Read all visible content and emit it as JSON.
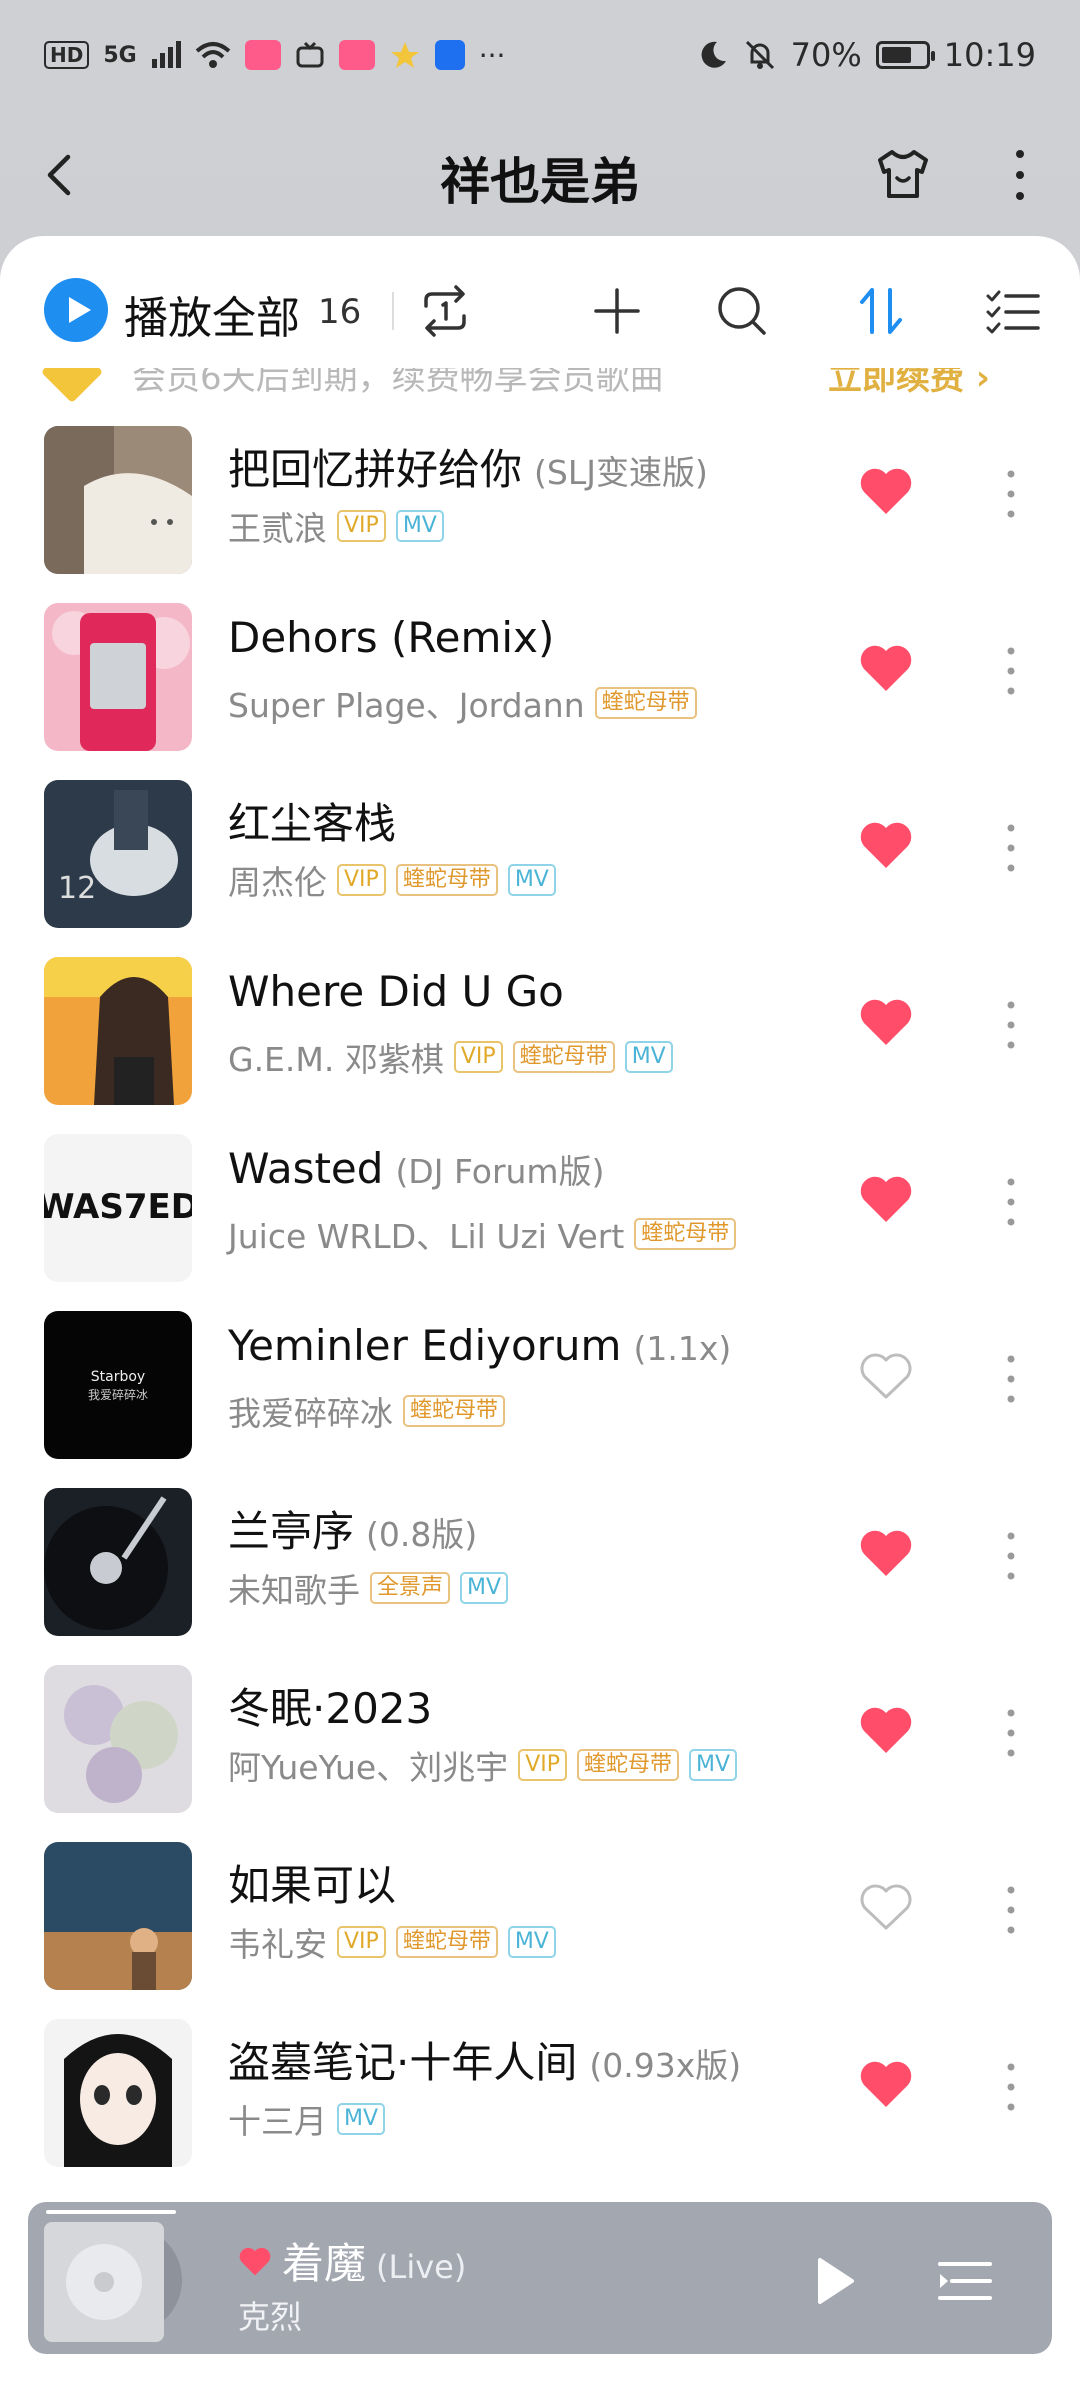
{
  "status_bar": {
    "hd": "HD",
    "network": "5G",
    "battery_percent": "70%",
    "battery_level": 0.7,
    "time": "10:19"
  },
  "header": {
    "title": "祥也是弟"
  },
  "toolbar": {
    "play_all": "播放全部",
    "count": "16"
  },
  "vip_banner": {
    "text": "会员6天后到期，续费畅享会员歌曲",
    "action": "立即续费 ›"
  },
  "songs": [
    {
      "title": "把回忆拼好给你",
      "version": "(SLJ变速版)",
      "artist": "王贰浪",
      "tags": [
        "VIP",
        "MV"
      ],
      "liked": true
    },
    {
      "title": "Dehors (Remix)",
      "version": "",
      "artist": "Super Plage、Jordann",
      "tags": [
        "蝰蛇母带"
      ],
      "liked": true
    },
    {
      "title": "红尘客栈",
      "version": "",
      "artist": "周杰伦",
      "tags": [
        "VIP",
        "蝰蛇母带",
        "MV"
      ],
      "liked": true
    },
    {
      "title": "Where Did U Go",
      "version": "",
      "artist": "G.E.M. 邓紫棋",
      "tags": [
        "VIP",
        "蝰蛇母带",
        "MV"
      ],
      "liked": true
    },
    {
      "title": "Wasted",
      "version": "(DJ Forum版)",
      "artist": "Juice WRLD、Lil Uzi Vert",
      "tags": [
        "蝰蛇母带"
      ],
      "liked": true
    },
    {
      "title": "Yeminler Ediyorum",
      "version": "(1.1x)",
      "artist": "我爱碎碎冰",
      "tags": [
        "蝰蛇母带"
      ],
      "liked": false
    },
    {
      "title": "兰亭序",
      "version": "(0.8版)",
      "artist": "未知歌手",
      "tags": [
        "全景声",
        "MV"
      ],
      "liked": true
    },
    {
      "title": "冬眠·2023",
      "version": "",
      "artist": "阿YueYue、刘兆宇",
      "tags": [
        "VIP",
        "蝰蛇母带",
        "MV"
      ],
      "liked": true
    },
    {
      "title": "如果可以",
      "version": "",
      "artist": "韦礼安",
      "tags": [
        "VIP",
        "蝰蛇母带",
        "MV"
      ],
      "liked": false
    },
    {
      "title": "盗墓笔记·十年人间",
      "version": "(0.93x版)",
      "artist": "十三月",
      "tags": [
        "MV"
      ],
      "liked": true
    }
  ],
  "cover_text": {
    "wasted": "WAS7ED",
    "starboy_1": "Starboy",
    "starboy_2": "我爱碎碎冰"
  },
  "mini_player": {
    "title": "着魔",
    "version": "(Live)",
    "artist": "克烈",
    "liked": true
  },
  "colors": {
    "accent": "#1f8ef1",
    "heart": "#ff4d6a",
    "vip": "#e1a92a",
    "mv": "#4bb4d6",
    "quality": "#e0982d"
  }
}
